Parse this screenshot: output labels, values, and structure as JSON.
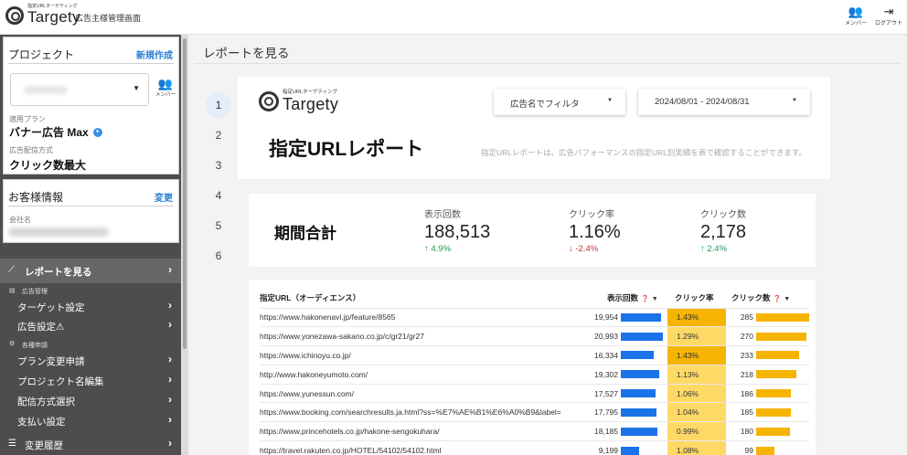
{
  "topbar": {
    "brand_sub": "指定URLターゲティング",
    "brand_name": "Targety",
    "title": "広告主様管理画面",
    "member_label": "メンバー",
    "logout_label": "ログアウト"
  },
  "project": {
    "heading": "プロジェクト",
    "new_link": "新規作成",
    "member_label": "メンバー",
    "plan_label": "適用プラン",
    "plan_value": "バナー広告 Max",
    "method_label": "広告配信方式",
    "method_value": "クリック数最大"
  },
  "customer": {
    "heading": "お客様情報",
    "change_link": "変更",
    "company_label": "会社名"
  },
  "nav": {
    "report": "レポートを見る",
    "group_ads": "広告管理",
    "target": "ターゲット設定",
    "ad_settings": "広告設定⚠",
    "group_apply": "各種申請",
    "plan_change": "プラン変更申請",
    "project_edit": "プロジェクト名編集",
    "delivery": "配信方式選択",
    "payment": "支払い設定",
    "history": "変更履歴"
  },
  "main": {
    "title": "レポートを見る",
    "steps": [
      "1",
      "2",
      "3",
      "4",
      "5",
      "6"
    ],
    "filter_label": "広告名でフィルタ",
    "date_range": "2024/08/01 - 2024/08/31",
    "report_title": "指定URLレポート",
    "report_desc": "指定URLレポートは、広告パフォーマンスの指定URL別実績を表で確認することができます。"
  },
  "kpi": {
    "heading": "期間合計",
    "items": [
      {
        "label": "表示回数",
        "value": "188,513",
        "delta": "↑ 4.9%"
      },
      {
        "label": "クリック率",
        "value": "1.16%",
        "delta": "↓ -2.4%"
      },
      {
        "label": "クリック数",
        "value": "2,178",
        "delta": "↑ 2.4%"
      }
    ]
  },
  "table": {
    "headers": {
      "url": "指定URL（オーディエンス）",
      "impressions": "表示回数",
      "ctr": "クリック率",
      "clicks": "クリック数"
    },
    "rows": [
      {
        "url": "https://www.hakonenavi.jp/feature/8565",
        "impressions": "19,954",
        "ctr": "1.43%",
        "clicks": "285"
      },
      {
        "url": "https://www.yonezawa-sakano.co.jp/c/gr21/gr27",
        "impressions": "20,993",
        "ctr": "1.29%",
        "clicks": "270"
      },
      {
        "url": "https://www.ichinoyu.co.jp/",
        "impressions": "16,334",
        "ctr": "1.43%",
        "clicks": "233"
      },
      {
        "url": "http://www.hakoneyumoto.com/",
        "impressions": "19,302",
        "ctr": "1.13%",
        "clicks": "218"
      },
      {
        "url": "https://www.yunessun.com/",
        "impressions": "17,527",
        "ctr": "1.06%",
        "clicks": "186"
      },
      {
        "url": "https://www.booking.com/searchresults.ja.html?ss=%E7%AE%B1%E6%A0%B9&label=...",
        "impressions": "17,795",
        "ctr": "1.04%",
        "clicks": "185"
      },
      {
        "url": "https://www.princehotels.co.jp/hakone-sengokuhara/",
        "impressions": "18,185",
        "ctr": "0.99%",
        "clicks": "180"
      },
      {
        "url": "https://travel.rakuten.co.jp/HOTEL/54102/54102.html",
        "impressions": "9,199",
        "ctr": "1.08%",
        "clicks": "99"
      }
    ]
  },
  "colors": {
    "impressions_bar": "#1a73e8",
    "clicks_bar": "#f5b400",
    "ctr_col": "#ffd966",
    "ctr_highlight": "#f5b400",
    "sidebar": "#4d4d4d",
    "link": "#2a7fd4"
  }
}
